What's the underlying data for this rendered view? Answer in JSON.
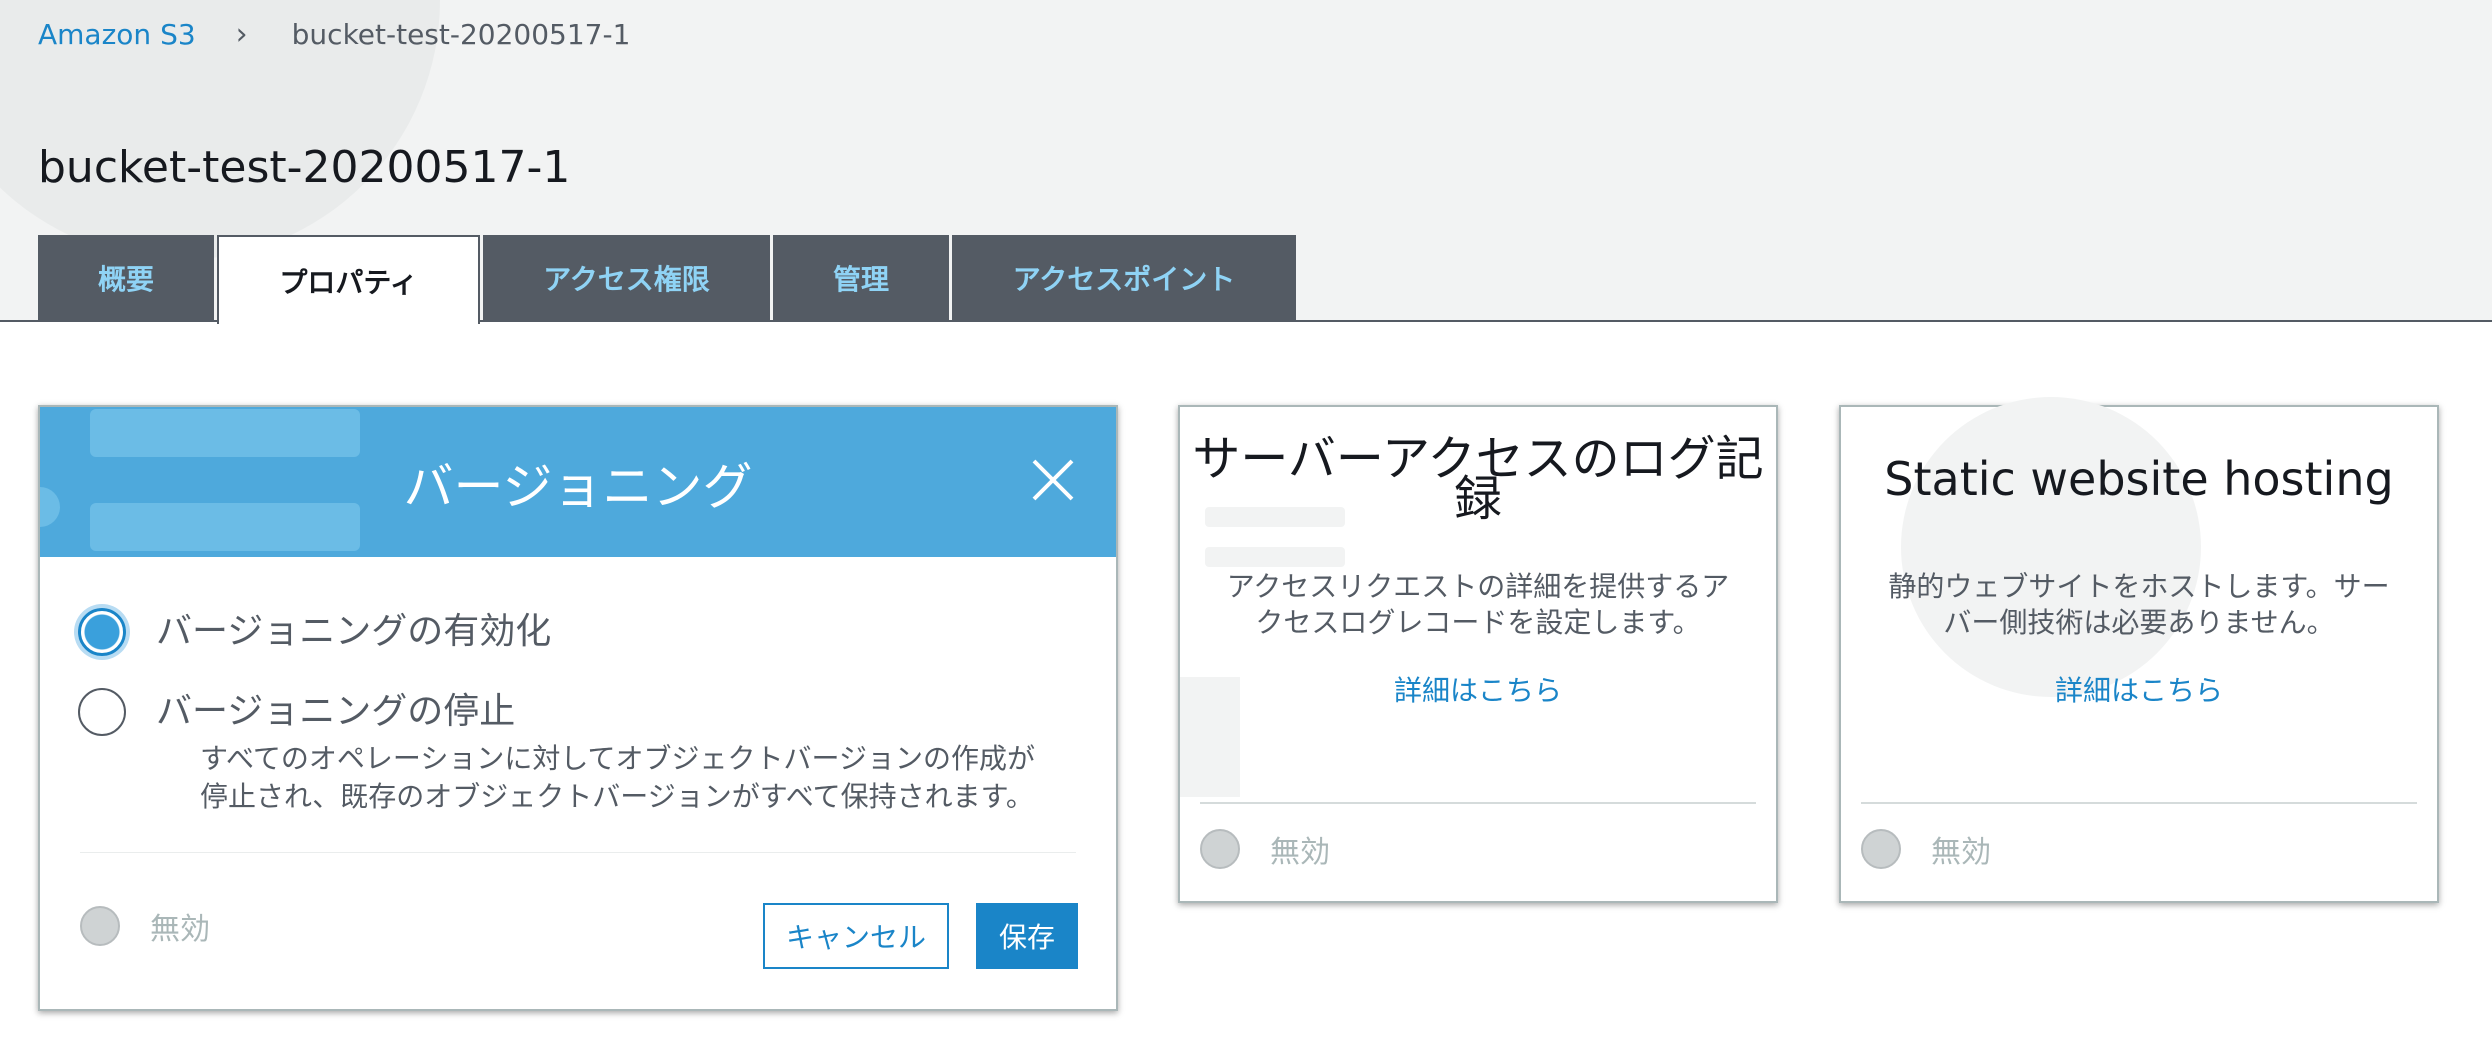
{
  "breadcrumb": {
    "root": "Amazon S3",
    "separator": "›",
    "current": "bucket-test-20200517-1"
  },
  "page_title": "bucket-test-20200517-1",
  "tabs": [
    {
      "label": "概要"
    },
    {
      "label": "プロパティ"
    },
    {
      "label": "アクセス権限"
    },
    {
      "label": "管理"
    },
    {
      "label": "アクセスポイント"
    }
  ],
  "versioning_card": {
    "title": "バージョニング",
    "options": [
      {
        "label": "バージョニングの有効化",
        "checked": true
      },
      {
        "label": "バージョニングの停止",
        "checked": false
      }
    ],
    "suspend_description_line1": "すべてのオペレーションに対してオブジェクトバージョンの作成が",
    "suspend_description_line2": "停止され、既存のオブジェクトバージョンがすべて保持されます。",
    "status": "無効",
    "cancel_label": "キャンセル",
    "save_label": "保存"
  },
  "logging_card": {
    "title_line1": "サーバーアクセスのログ記",
    "title_line2": "録",
    "description_line1": "アクセスリクエストの詳細を提供するア",
    "description_line2": "クセスログレコードを設定します。",
    "link": "詳細はこちら",
    "status": "無効"
  },
  "website_card": {
    "title": "Static website hosting",
    "description_line1": "静的ウェブサイトをホストします。サー",
    "description_line2": "バー側技術は必要ありません。",
    "link": "詳細はこちら",
    "status": "無効"
  },
  "colors": {
    "accent": "#1a85c8",
    "header_blue": "#4ea9dc",
    "tab_dark": "#545b64",
    "tab_text": "#8fd3f5",
    "disabled": "#aab7b8"
  }
}
